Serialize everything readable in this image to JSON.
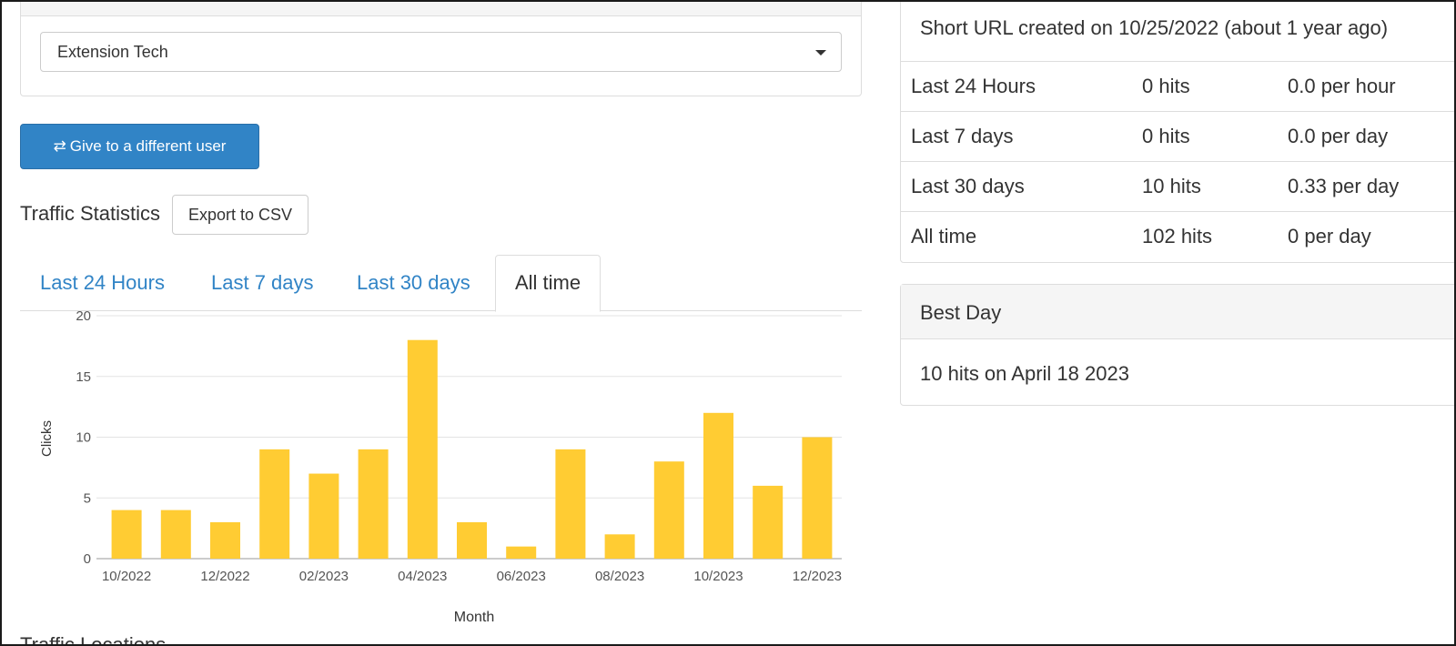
{
  "owner": {
    "selected_user": "Extension Tech"
  },
  "actions": {
    "give_button_label": "Give to a different user",
    "give_icon": "exchange-arrows-icon"
  },
  "stats": {
    "title": "Traffic Statistics",
    "export_label": "Export to CSV",
    "tabs": [
      {
        "label": "Last 24 Hours",
        "active": false
      },
      {
        "label": "Last 7 days",
        "active": false
      },
      {
        "label": "Last 30 days",
        "active": false
      },
      {
        "label": "All time",
        "active": true
      }
    ],
    "next_section_label": "Traffic Locations"
  },
  "chart_data": {
    "type": "bar",
    "categories": [
      "10/2022",
      "11/2022",
      "12/2022",
      "01/2023",
      "02/2023",
      "03/2023",
      "04/2023",
      "05/2023",
      "06/2023",
      "07/2023",
      "08/2023",
      "09/2023",
      "10/2023",
      "11/2023",
      "12/2023"
    ],
    "values": [
      4,
      4,
      3,
      9,
      7,
      9,
      18,
      3,
      1,
      9,
      2,
      8,
      12,
      6,
      10
    ],
    "tick_labels": [
      "10/2022",
      "12/2022",
      "02/2023",
      "04/2023",
      "06/2023",
      "08/2023",
      "10/2023",
      "12/2023"
    ],
    "xlabel": "Month",
    "ylabel": "Clicks",
    "ylim": [
      0,
      20
    ],
    "yticks": [
      0,
      5,
      10,
      15,
      20
    ],
    "grid": true,
    "bar_color": "#ffcc33"
  },
  "summary": {
    "created": "Short URL created on 10/25/2022 (about 1 year ago)",
    "rows": [
      {
        "period": "Last 24 Hours",
        "hits": "0 hits",
        "rate": "0.0 per hour"
      },
      {
        "period": "Last 7 days",
        "hits": "0 hits",
        "rate": "0.0 per day"
      },
      {
        "period": "Last 30 days",
        "hits": "10 hits",
        "rate": "0.33 per day"
      },
      {
        "period": "All time",
        "hits": "102 hits",
        "rate": "0 per day"
      }
    ]
  },
  "best_day": {
    "title": "Best Day",
    "text": "10 hits on April 18 2023"
  },
  "colors": {
    "primary": "#3184c6",
    "link": "#3184c6",
    "bar": "#ffcc33",
    "border": "#dddddd"
  }
}
